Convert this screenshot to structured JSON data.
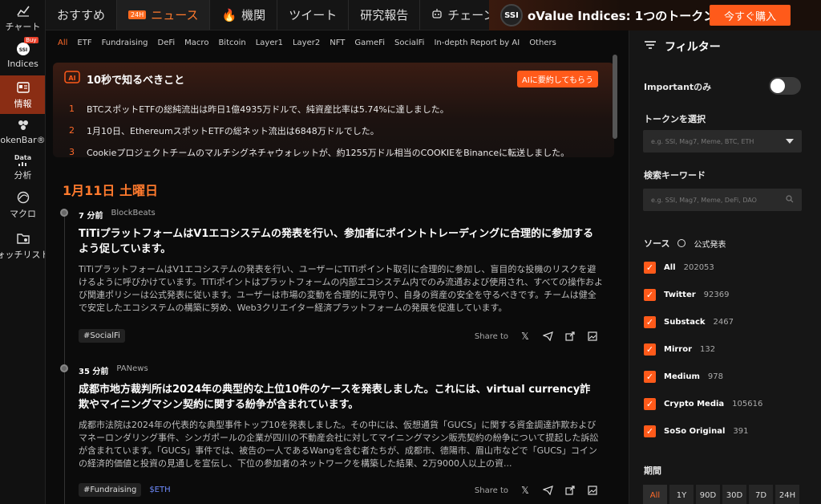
{
  "sidebar": {
    "items": [
      {
        "label": "チャート",
        "icon": "chart-icon"
      },
      {
        "label": "Indices",
        "icon": "ssi-icon",
        "badge": "Buy"
      },
      {
        "label": "情報",
        "icon": "news-icon",
        "active": true
      },
      {
        "label": "okenBar®",
        "icon": "token-icon"
      },
      {
        "label": "分析",
        "icon": "data-icon",
        "sub": "Data"
      },
      {
        "label": "マクロ",
        "icon": "macro-icon"
      },
      {
        "label": "ォッチリスト",
        "icon": "watchlist-icon"
      }
    ]
  },
  "tabs": [
    {
      "label": "おすすめ"
    },
    {
      "label": "ニュース",
      "active": true,
      "mini": "24H"
    },
    {
      "label": "機関",
      "prefix": "🔥"
    },
    {
      "label": "ツイート"
    },
    {
      "label": "研究報告"
    },
    {
      "label": "チェーン上"
    }
  ],
  "banner": {
    "logo": "SSI",
    "text_prefix": "oValue Indices: ",
    "text_highlight": "1",
    "text_suffix": "つのトークン",
    "buy_label": "今すぐ購入"
  },
  "categories": [
    "All",
    "ETF",
    "Fundraising",
    "DeFi",
    "Macro",
    "Bitcoin",
    "Layer1",
    "Layer2",
    "NFT",
    "GameFi",
    "SocialFi",
    "In-depth Report by AI",
    "Others"
  ],
  "summary": {
    "title": "10秒で知るべきこと",
    "ai_button": "AIに要約してもらう",
    "points": [
      {
        "n": "1",
        "text": "BTCスポットETFの総純流出は昨日1億4935万ドルで、純資産比率は5.74%に達しました。"
      },
      {
        "n": "2",
        "text": "1月10日、EthereumスポットETFの総ネット流出は6848万ドルでした。"
      },
      {
        "n": "3",
        "text": "Cookieプロジェクトチームのマルチシグネチャウォレットが、約1255万ドル相当のCOOKIEをBinanceに転送しました。"
      }
    ]
  },
  "date_heading": "1月11日 土曜日",
  "news": [
    {
      "time": "7 分前",
      "source": "BlockBeats",
      "title": "TiTiプラットフォームはV1エコシステムの発表を行い、参加者にポイントトレーディングに合理的に参加するよう促しています。",
      "body": "TiTiプラットフォームはV1エコシステムの発表を行い、ユーザーにTiTiポイント取引に合理的に参加し、盲目的な投機のリスクを避けるように呼びかけています。TiTiポイントはプラットフォームの内部エコシステム内でのみ流通および使用され、すべての操作および関連ポリシーは公式発表に従います。ユーザーは市場の変動を合理的に見守り、自身の資産の安全を守るべきです。チームは健全で安定したエコシステムの構築に努め、Web3クリエイター経済プラットフォームの発展を促進しています。",
      "tags": [
        "#SocialFi"
      ],
      "symbols": [],
      "share_label": "Share to"
    },
    {
      "time": "35 分前",
      "source": "PANews",
      "title": "成都市地方裁判所は2024年の典型的な上位10件のケースを発表しました。これには、virtual currency詐欺やマイニングマシン契約に関する紛争が含まれています。",
      "body": "成都市法院は2024年の代表的な典型事件トップ10を発表しました。その中には、仮想通貨「GUCS」に関する資金調達詐欺およびマネーロンダリング事件、シンガポールの企業が四川の不動産会社に対してマイニングマシン販売契約の紛争について提起した訴訟が含まれています。「GUCS」事件では、被告の一人であるWangを含む者たちが、成都市、德陽市、眉山市などで「GUCS」コインの経済的価値と投資の見通しを宣伝し、下位の参加者のネットワークを構築した結果、2万9000人以上の資...",
      "tags": [
        "#Fundraising"
      ],
      "symbols": [
        "$ETH"
      ],
      "share_label": "Share to"
    }
  ],
  "filter": {
    "title": "フィルター",
    "important_label": "Importantのみ",
    "token_label": "トークンを選択",
    "token_placeholder": "e.g. SSI, Mag7, Meme, BTC, ETH",
    "keyword_label": "検索キーワード",
    "keyword_placeholder": "e.g. SSI, Mag7, Meme, DeFi, DAO",
    "source_label": "ソース",
    "official_label": "公式発表",
    "sources": [
      {
        "name": "All",
        "count": "202053"
      },
      {
        "name": "Twitter",
        "count": "92369"
      },
      {
        "name": "Substack",
        "count": "2467"
      },
      {
        "name": "Mirror",
        "count": "132"
      },
      {
        "name": "Medium",
        "count": "978"
      },
      {
        "name": "Crypto Media",
        "count": "105616"
      },
      {
        "name": "SoSo Original",
        "count": "391"
      }
    ],
    "period_label": "期間",
    "periods": [
      "All",
      "1Y",
      "90D",
      "30D",
      "7D",
      "24H"
    ]
  },
  "colors": {
    "accent": "#ff5a1a",
    "background": "#0b0b0b",
    "panel": "#161616"
  }
}
